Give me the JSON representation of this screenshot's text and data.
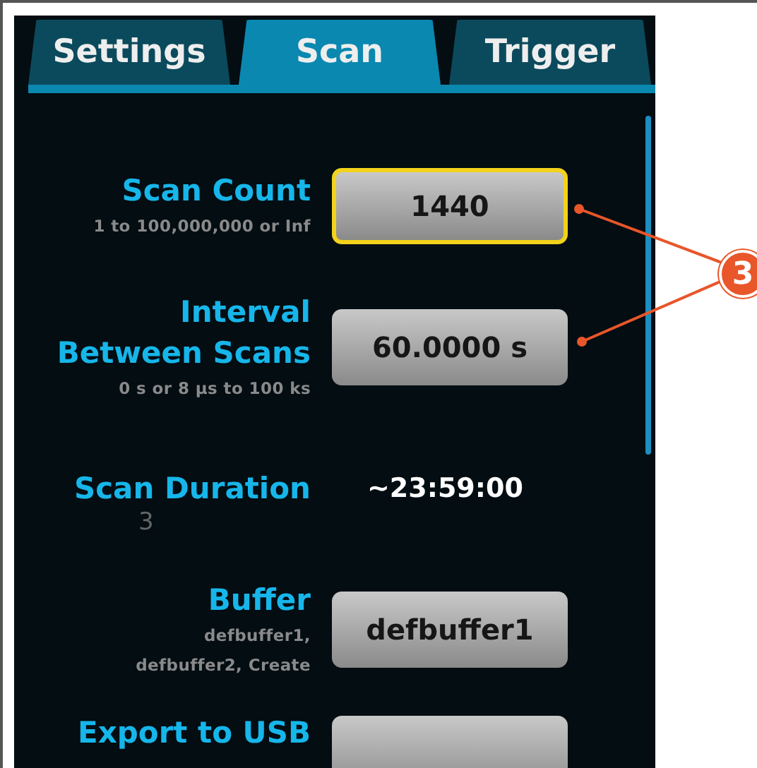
{
  "tabs": [
    {
      "label": "Settings",
      "selected": false
    },
    {
      "label": "Scan",
      "selected": true
    },
    {
      "label": "Trigger",
      "selected": false
    }
  ],
  "rows": [
    {
      "kind": "button",
      "label_lines": [
        "Scan Count"
      ],
      "hint_lines": [
        "1 to 100,000,000 or Inf"
      ],
      "value": "1440",
      "selected": true
    },
    {
      "kind": "button",
      "label_lines": [
        "Interval",
        "Between Scans"
      ],
      "hint_lines": [
        "0 s or 8 µs to 100 ks"
      ],
      "value": "60.0000 s",
      "selected": false
    },
    {
      "kind": "value",
      "label_lines": [
        "Scan Duration"
      ],
      "hint_lines": [],
      "value": "~23:59:00",
      "mark": "3"
    },
    {
      "kind": "button",
      "label_lines": [
        "Buffer"
      ],
      "hint_lines": [
        "defbuffer1,",
        "defbuffer2, Create"
      ],
      "value": "defbuffer1",
      "selected": false
    },
    {
      "kind": "button",
      "label_lines": [
        "Export to USB"
      ],
      "hint_lines": [],
      "selected": false
    }
  ],
  "callout": {
    "number": "3"
  }
}
